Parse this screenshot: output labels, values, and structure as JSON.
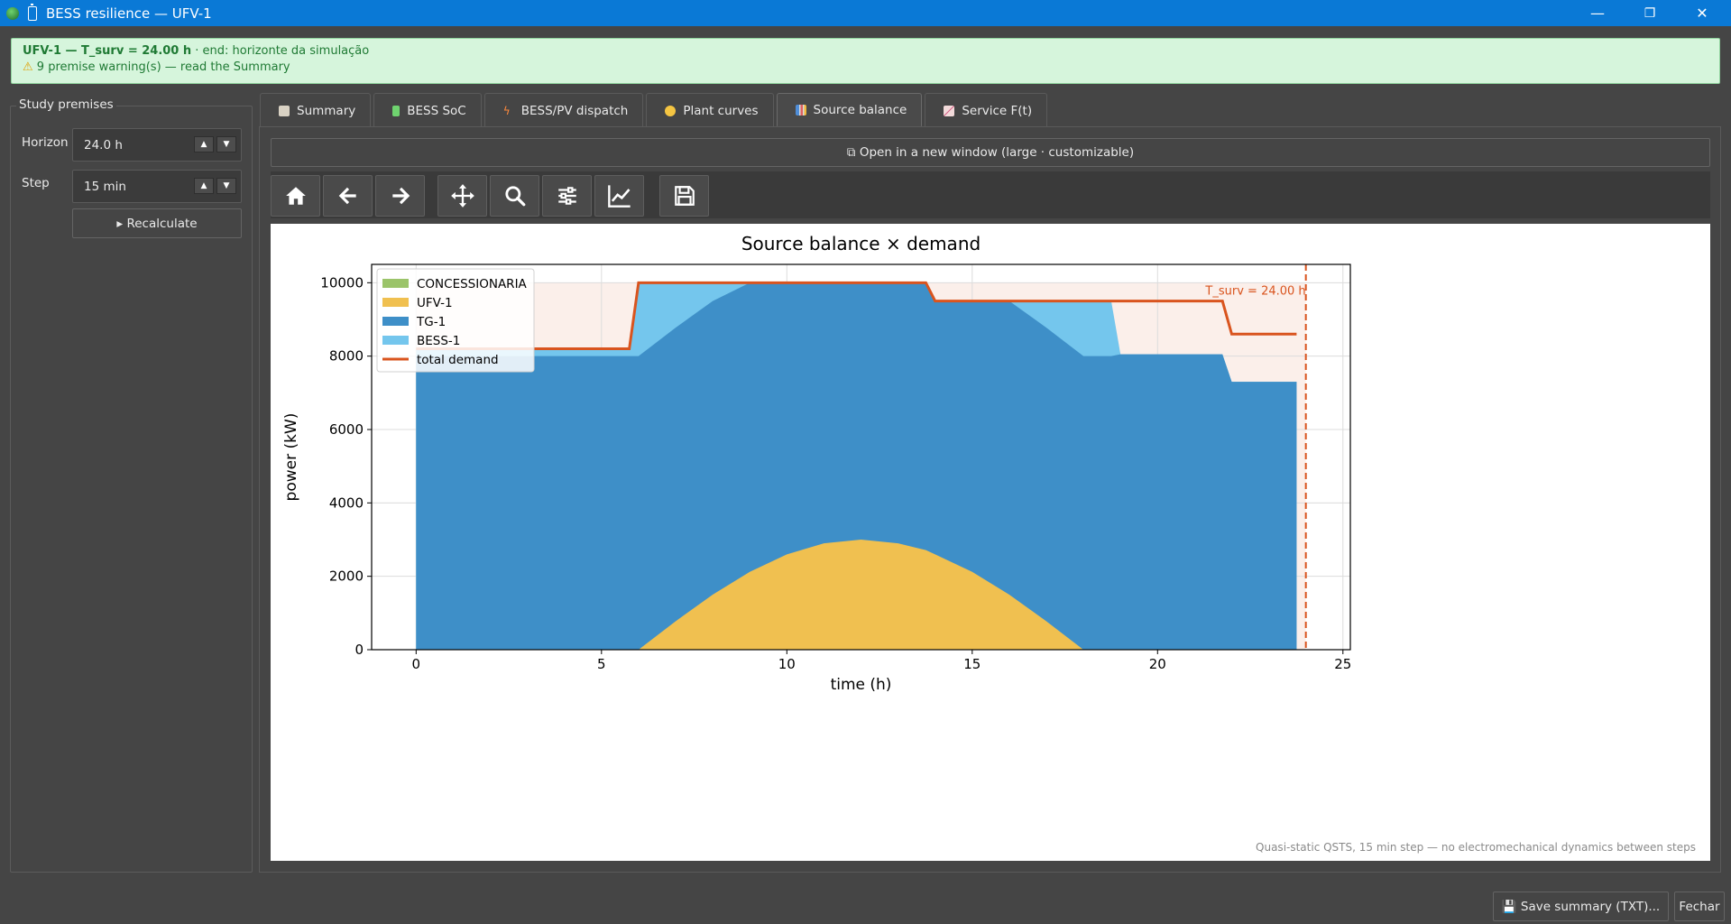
{
  "window": {
    "title": "BESS resilience — UFV-1",
    "minimize": "—",
    "maximize": "❐",
    "close": "✕"
  },
  "banner": {
    "line1_bold": "UFV-1 — T_surv = 24.00 h",
    "line1_rest": " · end: horizonte da simulação",
    "warning_icon": "⚠",
    "line2": " 9 premise warning(s) — read the Summary",
    "color_bg": "#d6f5dc",
    "color_text": "#1f7a34"
  },
  "premises": {
    "legend": "Study premises",
    "horizon_label": "Horizon",
    "horizon_value": "24.0 h",
    "step_label": "Step",
    "step_value": "15 min",
    "recalc_label": "▸ Recalculate"
  },
  "tabs": [
    {
      "label": "Summary",
      "icon": "summary-icon"
    },
    {
      "label": "BESS SoC",
      "icon": "battery-icon"
    },
    {
      "label": "BESS/PV dispatch",
      "icon": "lightning-icon"
    },
    {
      "label": "Plant curves",
      "icon": "face-icon"
    },
    {
      "label": "Source balance",
      "icon": "bar-chart-icon",
      "active": true
    },
    {
      "label": "Service F(t)",
      "icon": "line-chart-icon"
    }
  ],
  "open_window_label": "⧉ Open in a new window (large · customizable)",
  "toolbar": [
    "home-icon",
    "back-icon",
    "forward-icon",
    "pan-icon",
    "zoom-icon",
    "configure-icon",
    "edit-axes-icon",
    "save-figure-icon"
  ],
  "footer": {
    "save_label": "💾 Save summary (TXT)...",
    "close_label": "Fechar"
  },
  "chart_data": {
    "type": "area",
    "title": "Source balance × demand",
    "xlabel": "time (h)",
    "ylabel": "power (kW)",
    "xlim": [
      -1.2,
      25.2
    ],
    "ylim": [
      0,
      10500
    ],
    "xticks": [
      0,
      5,
      10,
      15,
      20,
      25
    ],
    "yticks": [
      0,
      2000,
      4000,
      6000,
      8000,
      10000
    ],
    "grid": true,
    "legend_position": "upper-left",
    "x": [
      0,
      1,
      2,
      3,
      4,
      5,
      5.75,
      6,
      7,
      8,
      9,
      10,
      11,
      12,
      13,
      13.75,
      14,
      15,
      16,
      17,
      18,
      18.75,
      19,
      20,
      21,
      21.75,
      22,
      23,
      23.75
    ],
    "series": [
      {
        "name": "CONCESSIONARIA",
        "color": "#9bc46a",
        "values": [
          0,
          0,
          0,
          0,
          0,
          0,
          0,
          0,
          0,
          0,
          0,
          0,
          0,
          0,
          0,
          0,
          0,
          0,
          0,
          0,
          0,
          0,
          0,
          0,
          0,
          0,
          0,
          0,
          0
        ]
      },
      {
        "name": "UFV-1",
        "color": "#f0c050",
        "values": [
          0,
          0,
          0,
          0,
          0,
          0,
          0,
          0,
          776,
          1500,
          2121,
          2598,
          2898,
          3000,
          2898,
          2714,
          2598,
          2121,
          1500,
          776,
          0,
          0,
          0,
          0,
          0,
          0,
          0,
          0,
          0
        ]
      },
      {
        "name": "TG-1",
        "color": "#3e8fc8",
        "values": [
          8000,
          8000,
          8000,
          8000,
          8000,
          8000,
          8000,
          8000,
          8776,
          9500,
          10000,
          10000,
          10000,
          10000,
          10000,
          10000,
          9500,
          9500,
          9500,
          8776,
          8000,
          8000,
          8050,
          8050,
          8050,
          8050,
          7300,
          7300,
          7300
        ]
      },
      {
        "name": "BESS-1",
        "color": "#74c6ed",
        "values": [
          8200,
          8200,
          8200,
          8200,
          8200,
          8200,
          8200,
          10000,
          10000,
          10000,
          10000,
          10000,
          10000,
          10000,
          10000,
          10000,
          9500,
          9500,
          9500,
          9500,
          9500,
          9500,
          8050,
          8050,
          8050,
          8050,
          7300,
          7300,
          7300
        ]
      }
    ],
    "demand": {
      "name": "total demand",
      "color": "#d9541e",
      "x": [
        0,
        5.75,
        6,
        13.75,
        14,
        21.75,
        22,
        23.75
      ],
      "values": [
        8200,
        8200,
        10000,
        10000,
        9500,
        9500,
        8600,
        8600
      ]
    },
    "t_surv": {
      "x": 24,
      "label": "T_surv = 24.00 h",
      "color": "#d9541e"
    },
    "footnote": "Quasi-static QSTS, 15 min step — no electromechanical dynamics between steps"
  }
}
